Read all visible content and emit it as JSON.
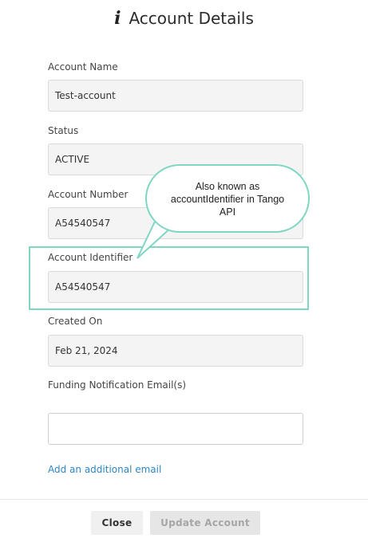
{
  "header": {
    "title": "Account Details",
    "icon": "i"
  },
  "fields": {
    "account_name": {
      "label": "Account Name",
      "value": "Test-account"
    },
    "status": {
      "label": "Status",
      "value": "ACTIVE"
    },
    "account_number": {
      "label": "Account Number",
      "value": "A54540547"
    },
    "account_identifier": {
      "label": "Account Identifier",
      "value": "A54540547"
    },
    "created_on": {
      "label": "Created On",
      "value": "Feb 21, 2024"
    },
    "funding_email": {
      "label": "Funding Notification Email(s)",
      "value": ""
    }
  },
  "callout": {
    "line1": "Also known as",
    "line2": "accountIdentifier in Tango",
    "line3": "API",
    "color": "#7fd6c2"
  },
  "links": {
    "add_email": "Add an additional email"
  },
  "footer": {
    "close_label": "Close",
    "update_label": "Update Account"
  },
  "colors": {
    "link": "#2e86c1",
    "highlight": "#7fd6c2"
  }
}
